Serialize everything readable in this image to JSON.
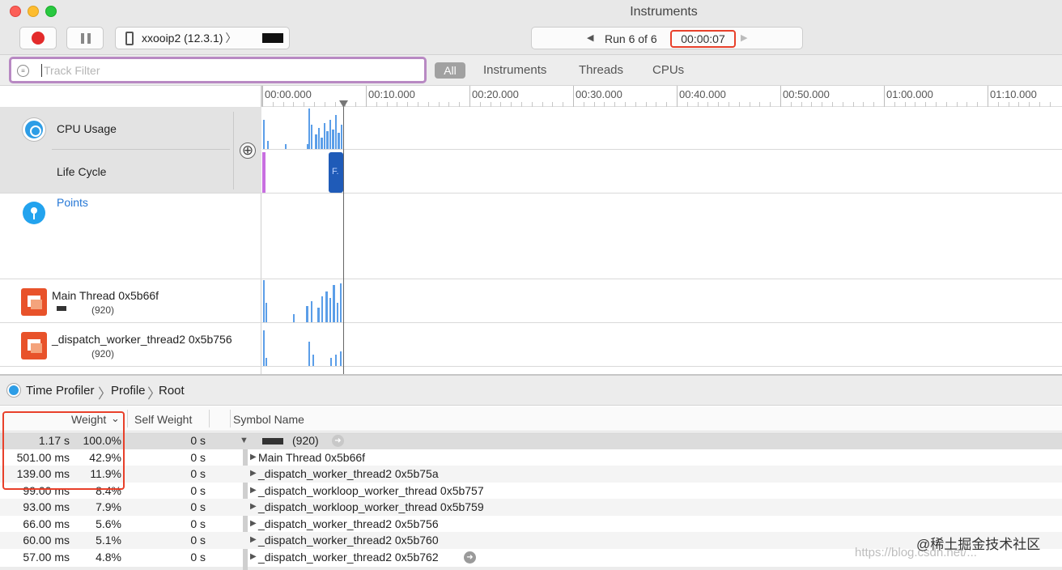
{
  "window": {
    "title": "Instruments"
  },
  "toolbar": {
    "device_label": "xxooip2 (12.3.1)",
    "device_chevron": "〉",
    "run_label": "Run 6 of 6",
    "run_time": "00:00:07",
    "prev_arrow": "◀",
    "next_arrow": "▶"
  },
  "filter": {
    "placeholder": "Track Filter",
    "icon": "≡",
    "scopes": {
      "all": "All",
      "instruments": "Instruments",
      "threads": "Threads",
      "cpus": "CPUs"
    }
  },
  "ruler": {
    "ticks": [
      "00:00.000",
      "00:10.000",
      "00:20.000",
      "00:30.000",
      "00:40.000",
      "00:50.000",
      "01:00.000",
      "01:10.000"
    ]
  },
  "tracks": {
    "cpu_usage": "CPU Usage",
    "life_cycle": "Life Cycle",
    "life_cycle_block": "F.",
    "points": "Points",
    "add": "⊕",
    "main_thread": {
      "label": "Main Thread  0x5b66f",
      "pid": "(920)"
    },
    "worker_thread": {
      "label": "_dispatch_worker_thread2  0x5b756",
      "pid": "(920)"
    }
  },
  "breadcrumbs": [
    "Time Profiler",
    "Profile",
    "Root"
  ],
  "breadcrumb_sep": "〉",
  "table": {
    "headers": {
      "weight": "Weight",
      "weight_sort": "⌄",
      "self_weight": "Self Weight",
      "symbol": "Symbol Name"
    },
    "root_pid": "(920)",
    "rows": [
      {
        "weight": "1.17 s",
        "pct": "100.0%",
        "self": "0 s",
        "symbol": ""
      },
      {
        "weight": "501.00 ms",
        "pct": "42.9%",
        "self": "0 s",
        "symbol": "Main Thread  0x5b66f"
      },
      {
        "weight": "139.00 ms",
        "pct": "11.9%",
        "self": "0 s",
        "symbol": "_dispatch_worker_thread2  0x5b75a"
      },
      {
        "weight": "99.00 ms",
        "pct": "8.4%",
        "self": "0 s",
        "symbol": "_dispatch_workloop_worker_thread  0x5b757"
      },
      {
        "weight": "93.00 ms",
        "pct": "7.9%",
        "self": "0 s",
        "symbol": "_dispatch_workloop_worker_thread  0x5b759"
      },
      {
        "weight": "66.00 ms",
        "pct": "5.6%",
        "self": "0 s",
        "symbol": "_dispatch_worker_thread2  0x5b756"
      },
      {
        "weight": "60.00 ms",
        "pct": "5.1%",
        "self": "0 s",
        "symbol": "_dispatch_worker_thread2  0x5b760"
      },
      {
        "weight": "57.00 ms",
        "pct": "4.8%",
        "self": "0 s",
        "symbol": "_dispatch_worker_thread2  0x5b762"
      }
    ]
  },
  "watermark": "@稀土掘金技术社区",
  "watermark_url": "https://blog.csdn.net/..."
}
